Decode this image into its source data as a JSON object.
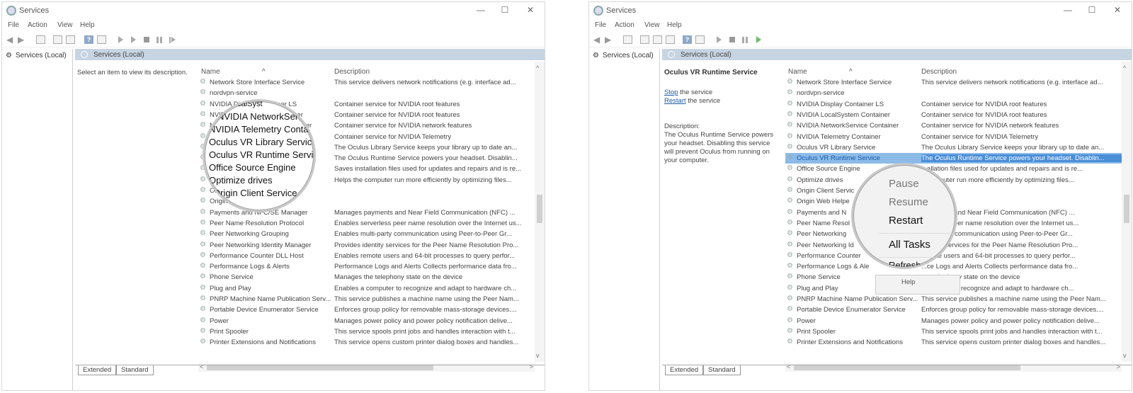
{
  "windows": [
    {
      "title": "Services",
      "menu": [
        "File",
        "Action",
        "View",
        "Help"
      ],
      "tree_item": "Services (Local)",
      "header_title": "Services (Local)",
      "description_prompt": "Select an item to view its description.",
      "columns": {
        "name": "Name",
        "description": "Description"
      },
      "rows": [
        {
          "name": "Network Store Interface Service",
          "description": "This service delivers network notifications (e.g. interface ad..."
        },
        {
          "name": "nordvpn-service",
          "description": ""
        },
        {
          "name": "NVIDIA Display Container LS",
          "description": "Container service for NVIDIA root features"
        },
        {
          "name": "NVIDIA LocalSystem Container",
          "description": "Container service for NVIDIA root features"
        },
        {
          "name": "NVIDIA NetworkService Container",
          "description": "Container service for NVIDIA network features"
        },
        {
          "name": "NVIDIA Telemetry Container",
          "description": "Container service for NVIDIA Telemetry"
        },
        {
          "name": "Oculus VR Library Service",
          "description": "The Oculus Library Service keeps your library up to date an..."
        },
        {
          "name": "Oculus VR Runtime Service",
          "description": "The Oculus Runtime Service powers your headset. Disablin..."
        },
        {
          "name": "Office  Source Engine",
          "description": "Saves installation files used for updates and repairs and is re..."
        },
        {
          "name": "Optimize drives",
          "description": "Helps the computer run more efficiently by optimizing files..."
        },
        {
          "name": "Origin Client Service",
          "description": ""
        },
        {
          "name": "Origin Web Helper Service",
          "description": ""
        },
        {
          "name": "Payments and NFC/SE Manager",
          "description": "Manages payments and Near Field Communication (NFC) ..."
        },
        {
          "name": "Peer Name Resolution Protocol",
          "description": "Enables serverless peer name resolution over the Internet us..."
        },
        {
          "name": "Peer Networking Grouping",
          "description": "Enables multi-party communication using Peer-to-Peer Gr..."
        },
        {
          "name": "Peer Networking Identity Manager",
          "description": "Provides identity services for the Peer Name Resolution Pro..."
        },
        {
          "name": "Performance Counter DLL Host",
          "description": "Enables remote users and 64-bit processes to query perfor..."
        },
        {
          "name": "Performance Logs & Alerts",
          "description": "Performance Logs and Alerts Collects performance data fro..."
        },
        {
          "name": "Phone Service",
          "description": "Manages the telephony state on the device"
        },
        {
          "name": "Plug and Play",
          "description": "Enables a computer to recognize and adapt to hardware ch..."
        },
        {
          "name": "PNRP Machine Name Publication Serv...",
          "description": "This service publishes a machine name using the Peer Nam..."
        },
        {
          "name": "Portable Device Enumerator Service",
          "description": "Enforces group policy for removable mass-storage devices...."
        },
        {
          "name": "Power",
          "description": "Manages power policy and power policy notification delive..."
        },
        {
          "name": "Print Spooler",
          "description": "This service spools print jobs and handles interaction with t..."
        },
        {
          "name": "Printer Extensions and Notifications",
          "description": "This service opens custom printer dialog boxes and handles..."
        }
      ],
      "tabs": [
        "Extended",
        "Standard"
      ],
      "magnifier_lines": [
        "ocalSyst",
        "NVIDIA NetworkService",
        "NVIDIA Telemetry Contair",
        "Oculus VR Library Service",
        "Oculus VR Runtime Service",
        "Office  Source Engine",
        "Optimize drives",
        "Origin Client Service"
      ]
    },
    {
      "title": "Services",
      "menu": [
        "File",
        "Action",
        "View",
        "Help"
      ],
      "tree_item": "Services (Local)",
      "header_title": "Services (Local)",
      "selected_service": "Oculus VR Runtime Service",
      "stop_link": "Stop",
      "stop_suffix": " the service",
      "restart_link": "Restart",
      "restart_suffix": " the service",
      "description_label": "Description:",
      "description_text": "The Oculus Runtime Service powers your headset. Disabling this service will prevent Oculus from running on your computer.",
      "columns": {
        "name": "Name",
        "description": "Description"
      },
      "rows": [
        {
          "name": "Network Store Interface Service",
          "description": "This service delivers network notifications (e.g. interface ad..."
        },
        {
          "name": "nordvpn-service",
          "description": ""
        },
        {
          "name": "NVIDIA Display Container LS",
          "description": "Container service for NVIDIA root features"
        },
        {
          "name": "NVIDIA LocalSystem Container",
          "description": "Container service for NVIDIA root features"
        },
        {
          "name": "NVIDIA NetworkService Container",
          "description": "Container service for NVIDIA network features"
        },
        {
          "name": "NVIDIA Telemetry Container",
          "description": "Container service for NVIDIA Telemetry"
        },
        {
          "name": "Oculus VR Library Service",
          "description": "The Oculus Library Service keeps your library up to date an..."
        },
        {
          "name": "Oculus VR Runtime Service",
          "description": "The Oculus Runtime Service powers your headset. Disablin..."
        },
        {
          "name": "Office  Source Engine",
          "description": "...allation files used for updates and repairs and is re..."
        },
        {
          "name": "Optimize drives",
          "description": "...computer run more efficiently by optimizing files..."
        },
        {
          "name": "Origin Client Servic",
          "description": ""
        },
        {
          "name": "Origin Web Helpe",
          "description": ""
        },
        {
          "name": "Payments and N",
          "description": "...ayments and Near Field Communication (NFC) ..."
        },
        {
          "name": "Peer Name Resol",
          "description": "...verless peer name resolution over the Internet us..."
        },
        {
          "name": "Peer Networking",
          "description": "...ulti-party communication using Peer-to-Peer Gr..."
        },
        {
          "name": "Peer Networking Id",
          "description": "...entity services for the Peer Name Resolution Pro..."
        },
        {
          "name": "Performance Counter",
          "description": "...mote users and 64-bit processes to query perfor..."
        },
        {
          "name": "Performance Logs & Ale",
          "description": "...ce Logs and Alerts Collects performance data fro..."
        },
        {
          "name": "Phone Service",
          "description": "...e telephony state on the device"
        },
        {
          "name": "Plug and Play",
          "description": "...omputer to recognize and adapt to hardware ch..."
        },
        {
          "name": "PNRP Machine Name Publication Serv...",
          "description": "This service publishes a machine name using the Peer Nam..."
        },
        {
          "name": "Portable Device Enumerator Service",
          "description": "Enforces group policy for removable mass-storage devices...."
        },
        {
          "name": "Power",
          "description": "Manages power policy and power policy notification delive..."
        },
        {
          "name": "Print Spooler",
          "description": "This service spools print jobs and handles interaction with t..."
        },
        {
          "name": "Printer Extensions and Notifications",
          "description": "This service opens custom printer dialog boxes and handles..."
        }
      ],
      "selected_index": 7,
      "tabs": [
        "Extended",
        "Standard"
      ],
      "context_menu": {
        "pause": "Pause",
        "resume": "Resume",
        "restart": "Restart",
        "all_tasks": "All Tasks",
        "refresh": "Refresh",
        "help": "Help"
      }
    }
  ],
  "colors": {
    "header_bg": "#c7d4e2",
    "selection": "#8cbbe8",
    "link": "#1a5aa8"
  }
}
